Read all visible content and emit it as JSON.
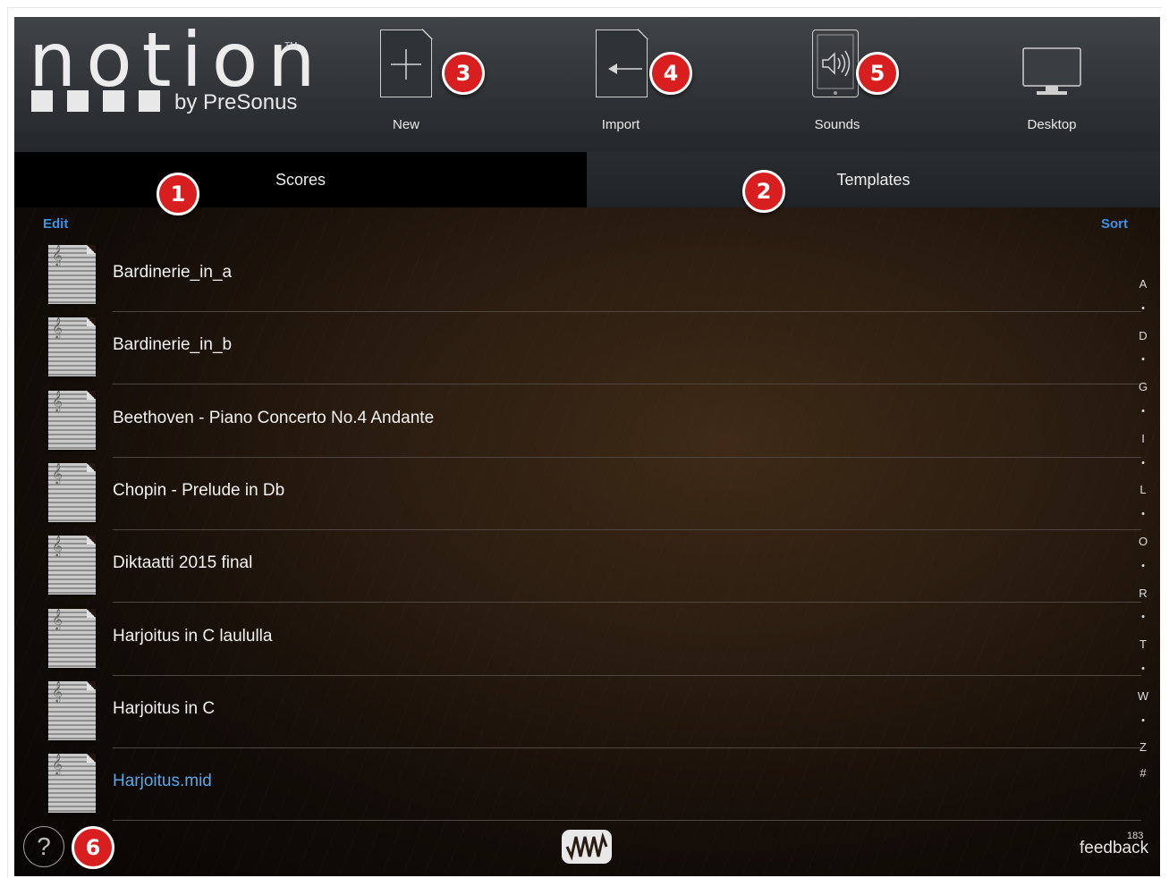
{
  "header": {
    "logo_word": "notion",
    "logo_tm": "TM",
    "logo_by": "by PreSonus",
    "tools": [
      {
        "label": "New",
        "icon": "new-document-icon"
      },
      {
        "label": "Import",
        "icon": "import-document-icon"
      },
      {
        "label": "Sounds",
        "icon": "sounds-tablet-icon"
      },
      {
        "label": "Desktop",
        "icon": "desktop-monitor-icon"
      }
    ]
  },
  "tabs": {
    "scores": "Scores",
    "templates": "Templates"
  },
  "list": {
    "edit": "Edit",
    "sort": "Sort",
    "items": [
      {
        "title": "Bardinerie_in_a"
      },
      {
        "title": "Bardinerie_in_b"
      },
      {
        "title": "Beethoven - Piano Concerto No.4 Andante"
      },
      {
        "title": "Chopin - Prelude in Db"
      },
      {
        "title": "Diktaatti 2015 final"
      },
      {
        "title": "Harjoitus in C laululla"
      },
      {
        "title": "Harjoitus in C"
      },
      {
        "title": "Harjoitus.mid"
      }
    ],
    "index_letters": [
      "A",
      "•",
      "D",
      "•",
      "G",
      "•",
      "I",
      "•",
      "L",
      "•",
      "O",
      "•",
      "R",
      "•",
      "T",
      "•",
      "W",
      "•",
      "Z",
      "#"
    ],
    "count": "183"
  },
  "footer": {
    "help": "?",
    "feedback": "feedback"
  },
  "badges": [
    "1",
    "2",
    "3",
    "4",
    "5",
    "6"
  ],
  "colors": {
    "accent_blue": "#3b93e6",
    "badge_red": "#d81e1e",
    "header_bg": "#33363a"
  }
}
